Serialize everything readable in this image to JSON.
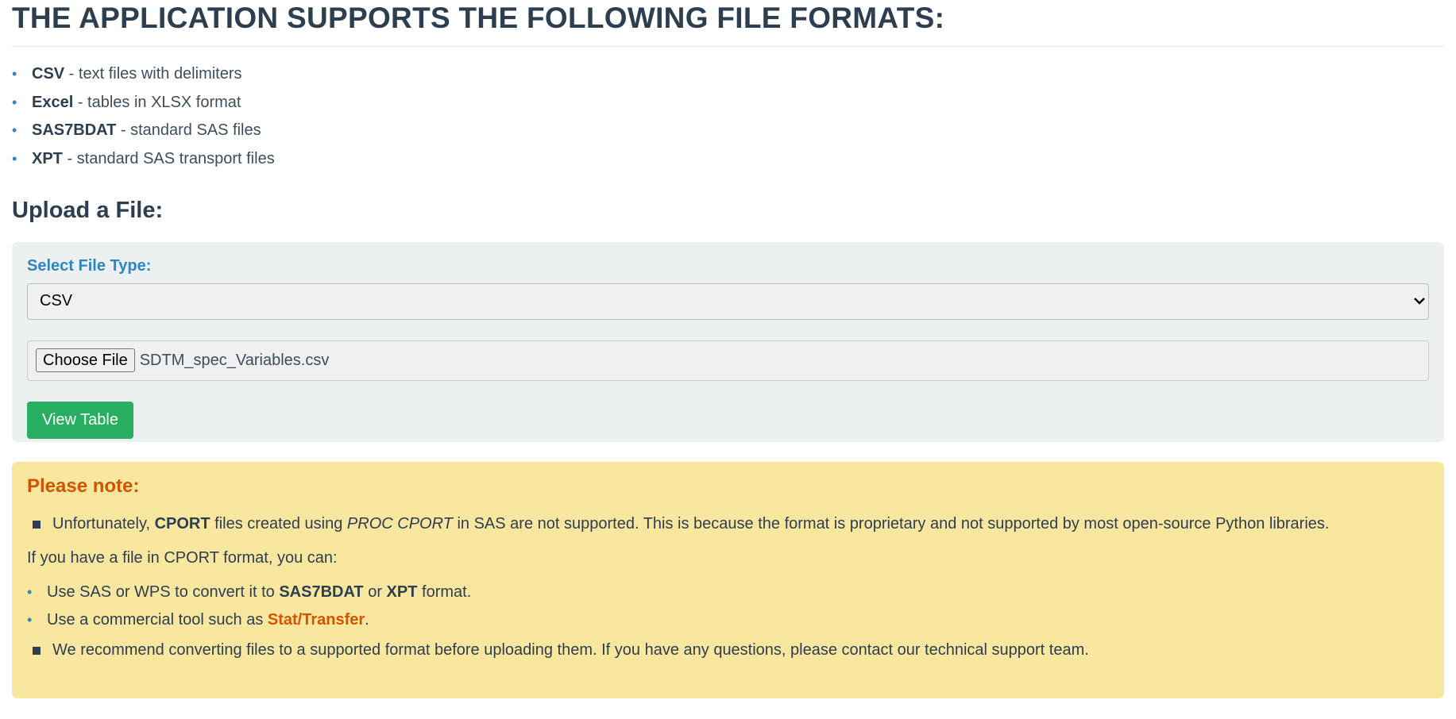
{
  "header": {
    "title": "THE APPLICATION SUPPORTS THE FOLLOWING FILE FORMATS:"
  },
  "formats": [
    {
      "name": "CSV",
      "desc": " - text files with delimiters"
    },
    {
      "name": "Excel",
      "desc": " - tables in XLSX format"
    },
    {
      "name": "SAS7BDAT",
      "desc": " - standard SAS files"
    },
    {
      "name": "XPT",
      "desc": " - standard SAS transport files"
    }
  ],
  "upload": {
    "heading": "Upload a File:",
    "select_label": "Select File Type:",
    "selected_type": "CSV",
    "choose_button": "Choose File",
    "file_name": "SDTM_spec_Variables.csv",
    "view_button": "View Table"
  },
  "note": {
    "title": "Please note:",
    "p1_a": "Unfortunately, ",
    "p1_b": "CPORT",
    "p1_c": " files created using ",
    "p1_d": "PROC CPORT",
    "p1_e": " in SAS are not supported. This is because the format is proprietary and not supported by most open-source Python libraries.",
    "p2": "If you have a file in CPORT format, you can:",
    "opt1_a": "Use SAS or WPS to convert it to ",
    "opt1_b": "SAS7BDAT",
    "opt1_c": " or ",
    "opt1_d": "XPT",
    "opt1_e": " format.",
    "opt2_a": "Use a commercial tool such as ",
    "opt2_b": "Stat/Transfer",
    "opt2_c": ".",
    "p3": "We recommend converting files to a supported format before uploading them. If you have any questions, please contact our technical support team."
  },
  "colors": {
    "accent_blue": "#2e86c1",
    "button_green": "#27ae60",
    "note_bg": "#f9e79f",
    "note_title": "#d35400"
  }
}
